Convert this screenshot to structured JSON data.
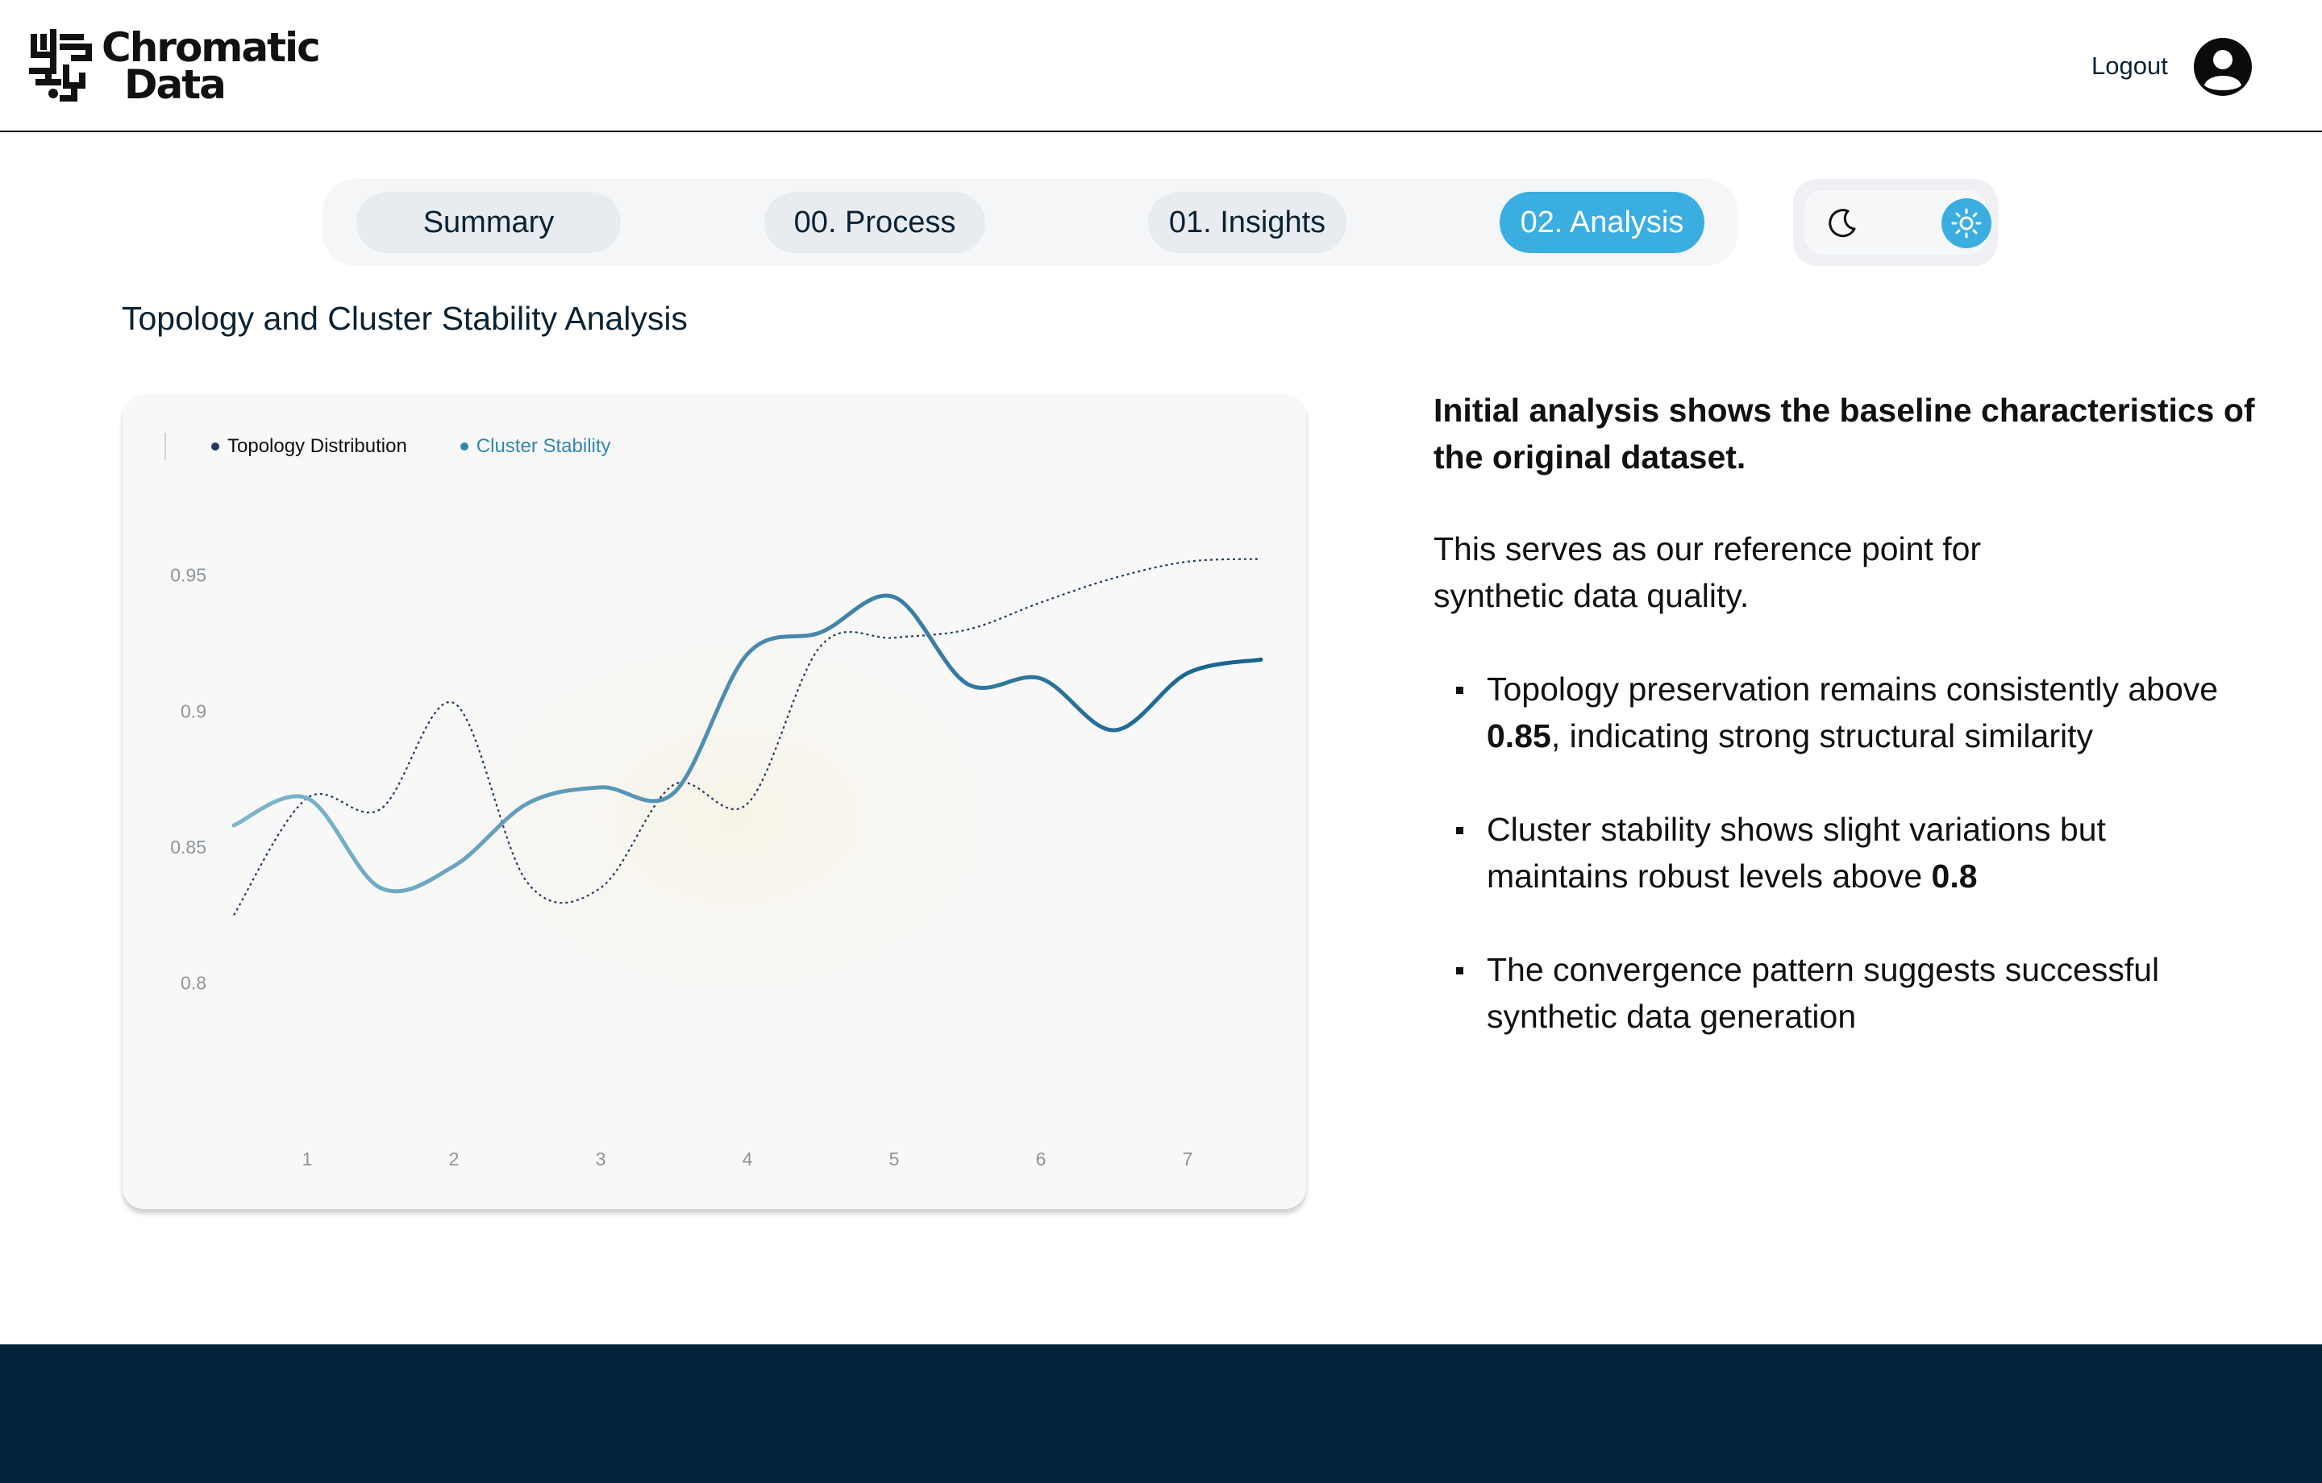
{
  "brand": {
    "name_line1": "Chromatic",
    "name_line2": "Data"
  },
  "header": {
    "logout_label": "Logout"
  },
  "nav": {
    "tabs": [
      {
        "label": "Summary",
        "active": false
      },
      {
        "label": "00. Process",
        "active": false
      },
      {
        "label": "01. Insights",
        "active": false
      },
      {
        "label": "02. Analysis",
        "active": true
      }
    ],
    "theme": {
      "options": [
        "moon-icon",
        "sun-icon"
      ],
      "selected": "light"
    }
  },
  "page": {
    "title": "Topology and Cluster Stability Analysis"
  },
  "colors": {
    "accent": "#3aaee0",
    "footer": "#03243a",
    "series_dark": "#1f3a5f",
    "series_blue": "#2f88b0"
  },
  "chart_data": {
    "type": "line",
    "categories": [
      "1",
      "2",
      "3",
      "4",
      "5",
      "6",
      "7"
    ],
    "x": [
      0.5,
      1,
      1.5,
      2,
      2.5,
      3,
      3.5,
      4,
      4.5,
      5,
      5.5,
      6,
      6.5,
      7,
      7.5
    ],
    "ylim": [
      0.775,
      0.96
    ],
    "yticks": [
      "0.95",
      "0.9",
      "0.85",
      "0.8"
    ],
    "ytick_values": [
      0.95,
      0.9,
      0.85,
      0.8
    ],
    "legend_position": "top-left",
    "series": [
      {
        "name": "Topology Distribution",
        "style": "dotted",
        "values": [
          0.825,
          0.868,
          0.864,
          0.903,
          0.837,
          0.835,
          0.873,
          0.866,
          0.924,
          0.927,
          0.93,
          0.94,
          0.949,
          0.955,
          0.956
        ]
      },
      {
        "name": "Cluster Stability",
        "style": "solid",
        "values": [
          0.858,
          0.868,
          0.835,
          0.843,
          0.866,
          0.872,
          0.87,
          0.921,
          0.929,
          0.942,
          0.91,
          0.912,
          0.893,
          0.914,
          0.919
        ]
      }
    ]
  },
  "analysis": {
    "lead": "Initial analysis shows the baseline characteristics of the original dataset.",
    "para": "This serves as our reference point for synthetic data quality.",
    "bullets": [
      {
        "pre": "Topology preservation remains consistently above ",
        "bold": "0.85",
        "post": ", indicating strong structural similarity"
      },
      {
        "pre": "Cluster stability shows slight variations but maintains robust levels above ",
        "bold": "0.8",
        "post": ""
      },
      {
        "pre": "The convergence pattern suggests successful synthetic data generation",
        "bold": "",
        "post": ""
      }
    ]
  }
}
